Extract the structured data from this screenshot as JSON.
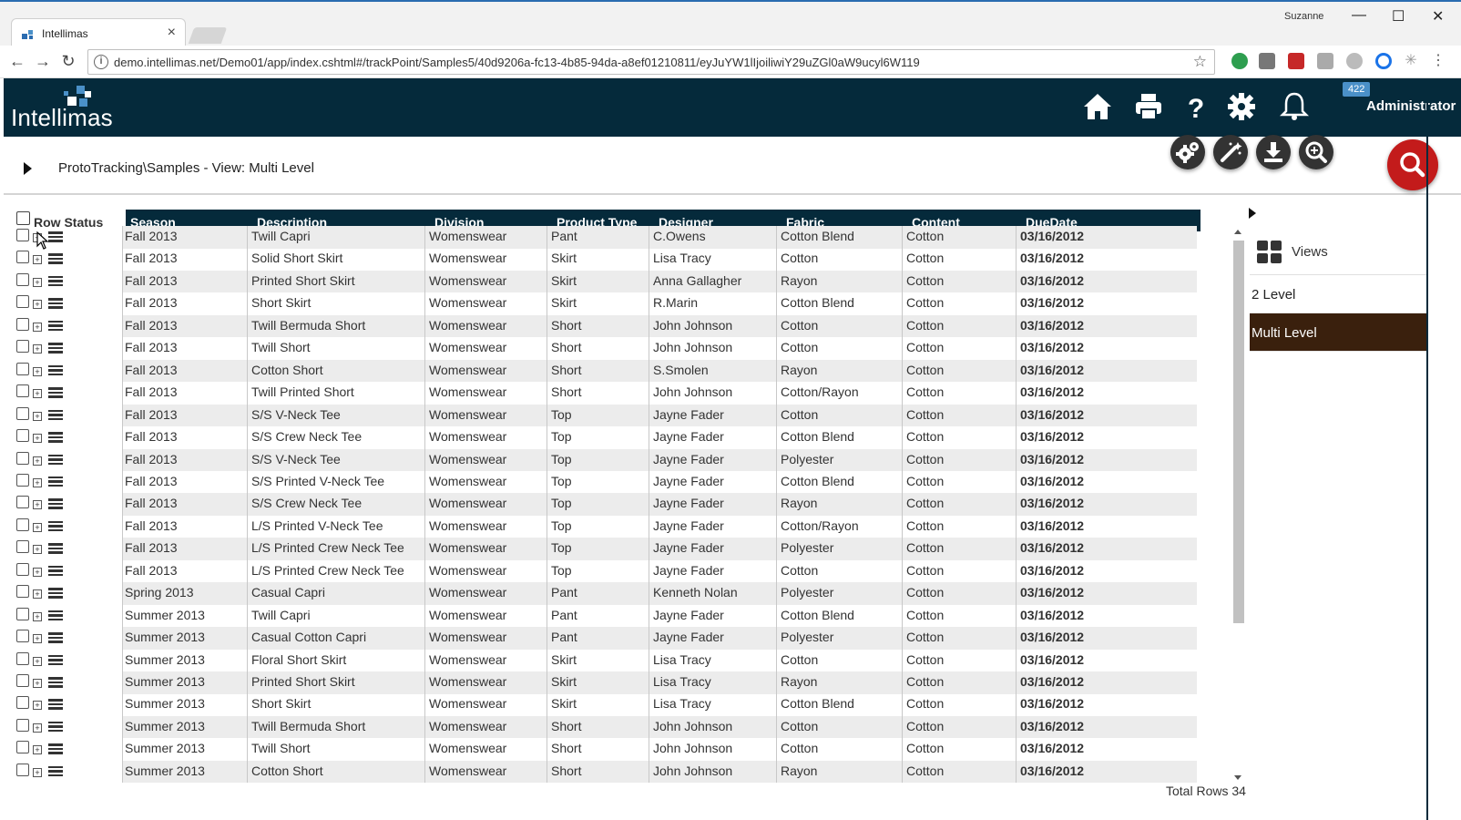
{
  "browser": {
    "tab_title": "Intellimas",
    "tab_close": "×",
    "user": "Suzanne",
    "url": "demo.intellimas.net/Demo01/app/index.cshtml#/trackPoint/Samples5/40d9206a-fc13-4b85-94da-a8ef01210811/eyJuYW1lIjoiliwiY29uZGl0aW9ucyl6W119",
    "win_minimize": "—",
    "win_maximize": "☐",
    "win_close": "✕",
    "back": "←",
    "forward": "→",
    "reload": "↻",
    "info": "i",
    "star": "☆"
  },
  "header": {
    "logo": "Intellimas",
    "notification_count": "422",
    "user": "Administrator",
    "icons": [
      "home-icon",
      "print-icon",
      "help-icon",
      "settings-icon",
      "bell-icon"
    ]
  },
  "breadcrumb": {
    "text": "ProtoTracking\\Samples - View: Multi Level"
  },
  "toolbar": {
    "icons": [
      "settings-gears-icon",
      "magic-wand-icon",
      "download-icon",
      "zoom-in-icon",
      "search-icon"
    ]
  },
  "grid": {
    "row_status_label": "Row Status",
    "columns": [
      "Season",
      "Description",
      "Division",
      "Product Type",
      "Designer",
      "Fabric",
      "Content",
      "DueDate"
    ],
    "rows": [
      [
        "Fall 2013",
        "Twill Capri",
        "Womenswear",
        "Pant",
        "C.Owens",
        "Cotton Blend",
        "Cotton",
        "03/16/2012"
      ],
      [
        "Fall 2013",
        "Solid Short Skirt",
        "Womenswear",
        "Skirt",
        "Lisa Tracy",
        "Cotton",
        "Cotton",
        "03/16/2012"
      ],
      [
        "Fall 2013",
        "Printed Short Skirt",
        "Womenswear",
        "Skirt",
        "Anna Gallagher",
        "Rayon",
        "Cotton",
        "03/16/2012"
      ],
      [
        "Fall 2013",
        "Short Skirt",
        "Womenswear",
        "Skirt",
        "R.Marin",
        "Cotton Blend",
        "Cotton",
        "03/16/2012"
      ],
      [
        "Fall 2013",
        "Twill Bermuda Short",
        "Womenswear",
        "Short",
        "John Johnson",
        "Cotton",
        "Cotton",
        "03/16/2012"
      ],
      [
        "Fall 2013",
        "Twill Short",
        "Womenswear",
        "Short",
        "John Johnson",
        "Cotton",
        "Cotton",
        "03/16/2012"
      ],
      [
        "Fall 2013",
        "Cotton Short",
        "Womenswear",
        "Short",
        "S.Smolen",
        "Rayon",
        "Cotton",
        "03/16/2012"
      ],
      [
        "Fall 2013",
        "Twill Printed Short",
        "Womenswear",
        "Short",
        "John Johnson",
        "Cotton/Rayon",
        "Cotton",
        "03/16/2012"
      ],
      [
        "Fall 2013",
        "S/S V-Neck Tee",
        "Womenswear",
        "Top",
        "Jayne Fader",
        "Cotton",
        "Cotton",
        "03/16/2012"
      ],
      [
        "Fall 2013",
        "S/S Crew Neck Tee",
        "Womenswear",
        "Top",
        "Jayne Fader",
        "Cotton Blend",
        "Cotton",
        "03/16/2012"
      ],
      [
        "Fall 2013",
        "S/S V-Neck Tee",
        "Womenswear",
        "Top",
        "Jayne Fader",
        "Polyester",
        "Cotton",
        "03/16/2012"
      ],
      [
        "Fall 2013",
        "S/S Printed V-Neck Tee",
        "Womenswear",
        "Top",
        "Jayne Fader",
        "Cotton Blend",
        "Cotton",
        "03/16/2012"
      ],
      [
        "Fall 2013",
        "S/S Crew Neck Tee",
        "Womenswear",
        "Top",
        "Jayne Fader",
        "Rayon",
        "Cotton",
        "03/16/2012"
      ],
      [
        "Fall 2013",
        "L/S Printed V-Neck Tee",
        "Womenswear",
        "Top",
        "Jayne Fader",
        "Cotton/Rayon",
        "Cotton",
        "03/16/2012"
      ],
      [
        "Fall 2013",
        "L/S Printed Crew Neck Tee",
        "Womenswear",
        "Top",
        "Jayne Fader",
        "Polyester",
        "Cotton",
        "03/16/2012"
      ],
      [
        "Fall 2013",
        "L/S Printed Crew Neck Tee",
        "Womenswear",
        "Top",
        "Jayne Fader",
        "Cotton",
        "Cotton",
        "03/16/2012"
      ],
      [
        "Spring 2013",
        "Casual Capri",
        "Womenswear",
        "Pant",
        "Kenneth Nolan",
        "Polyester",
        "Cotton",
        "03/16/2012"
      ],
      [
        "Summer 2013",
        "Twill Capri",
        "Womenswear",
        "Pant",
        "Jayne Fader",
        "Cotton Blend",
        "Cotton",
        "03/16/2012"
      ],
      [
        "Summer 2013",
        "Casual Cotton Capri",
        "Womenswear",
        "Pant",
        "Jayne Fader",
        "Polyester",
        "Cotton",
        "03/16/2012"
      ],
      [
        "Summer 2013",
        "Floral Short Skirt",
        "Womenswear",
        "Skirt",
        "Lisa Tracy",
        "Cotton",
        "Cotton",
        "03/16/2012"
      ],
      [
        "Summer 2013",
        "Printed Short Skirt",
        "Womenswear",
        "Skirt",
        "Lisa Tracy",
        "Rayon",
        "Cotton",
        "03/16/2012"
      ],
      [
        "Summer 2013",
        "Short Skirt",
        "Womenswear",
        "Skirt",
        "Lisa Tracy",
        "Cotton Blend",
        "Cotton",
        "03/16/2012"
      ],
      [
        "Summer 2013",
        "Twill Bermuda Short",
        "Womenswear",
        "Short",
        "John Johnson",
        "Cotton",
        "Cotton",
        "03/16/2012"
      ],
      [
        "Summer 2013",
        "Twill Short",
        "Womenswear",
        "Short",
        "John Johnson",
        "Cotton",
        "Cotton",
        "03/16/2012"
      ],
      [
        "Summer 2013",
        "Cotton Short",
        "Womenswear",
        "Short",
        "John Johnson",
        "Rayon",
        "Cotton",
        "03/16/2012"
      ]
    ],
    "total_rows": "Total Rows 34"
  },
  "views": {
    "title": "Views",
    "items": [
      "2 Level",
      "Multi Level"
    ],
    "selected": "Multi Level"
  },
  "colors": {
    "header_bg": "#052a3b",
    "search_button": "#c31b1b",
    "selected_view": "#3a200d",
    "badge": "#4a90c8"
  }
}
